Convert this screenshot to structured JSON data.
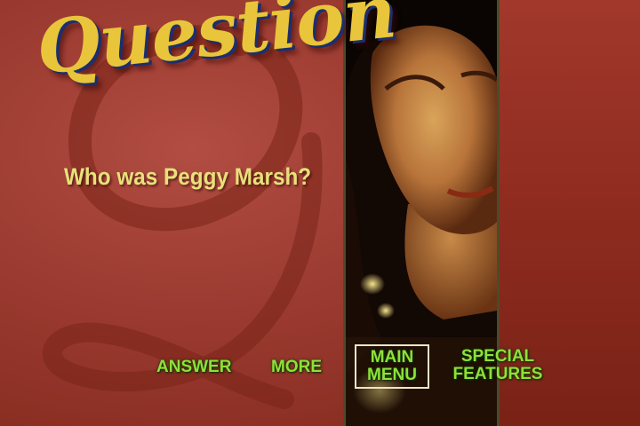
{
  "screen": {
    "title": "Question",
    "question": "Who was Peggy Marsh?"
  },
  "menu": {
    "answer": "ANSWER",
    "more": "MORE",
    "main_menu_line1": "MAIN",
    "main_menu_line2": "MENU",
    "special_features_line1": "SPECIAL",
    "special_features_line2": "FEATURES"
  },
  "colors": {
    "background": "#9c3b31",
    "title": "#e8c53a",
    "title_shadow": "#1c2f6e",
    "question_text": "#e8e07a",
    "menu_text": "#8ee03a",
    "selection_box": "#ede6c8"
  }
}
